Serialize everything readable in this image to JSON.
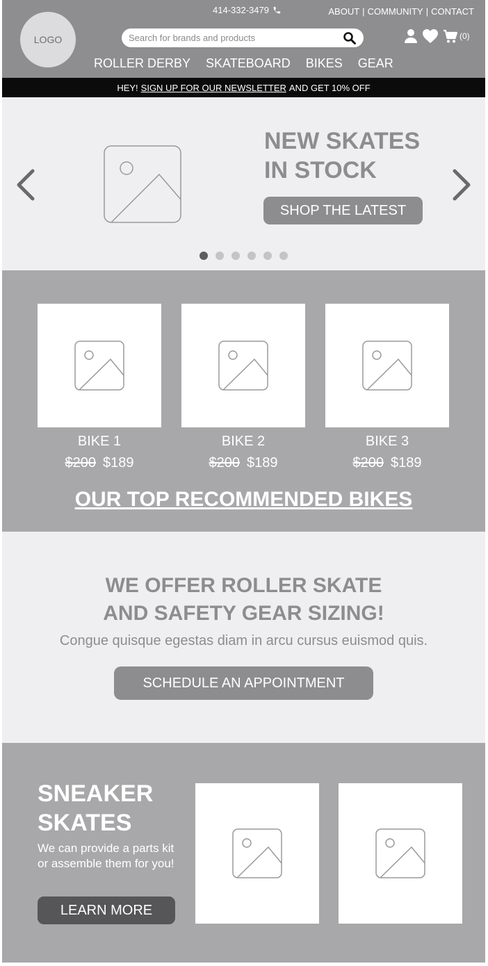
{
  "header": {
    "logo": "LOGO",
    "phone": "414-332-3479",
    "toplinks": [
      "ABOUT",
      "COMMUNITY",
      "CONTACT"
    ],
    "search_placeholder": "Search for brands and products",
    "cart_count": "(0)",
    "nav": [
      "ROLLER DERBY",
      "SKATEBOARD",
      "BIKES",
      "GEAR"
    ]
  },
  "banner": {
    "prefix": "HEY!",
    "link": "SIGN UP FOR OUR NEWSLETTER",
    "suffix": "AND GET 10% OFF"
  },
  "hero": {
    "title_line1": "NEW SKATES",
    "title_line2": "IN STOCK",
    "button": "SHOP THE LATEST",
    "slides_total": 6,
    "active_slide": 1
  },
  "bikes": {
    "items": [
      {
        "name": "BIKE 1",
        "old_price": "$200",
        "price": "$189"
      },
      {
        "name": "BIKE 2",
        "old_price": "$200",
        "price": "$189"
      },
      {
        "name": "BIKE 3",
        "old_price": "$200",
        "price": "$189"
      }
    ],
    "title": "OUR TOP RECOMMENDED BIKES"
  },
  "sizing": {
    "title_line1": "WE OFFER ROLLER SKATE",
    "title_line2": "AND SAFETY GEAR SIZING!",
    "text": "Congue quisque egestas diam in arcu cursus euismod quis.",
    "button": "SCHEDULE AN APPOINTMENT"
  },
  "sneaker": {
    "title_line1": "SNEAKER",
    "title_line2": "SKATES",
    "text": "We can provide a parts kit or assemble them for you!",
    "button": "LEARN MORE"
  },
  "colors": {
    "header_bg": "#8e8e90",
    "banner_bg": "#0b0b0b",
    "light_bg": "#efeff1",
    "mid_bg": "#a8a8aa",
    "button_gray": "#8d8d8f",
    "button_dark": "#565658"
  }
}
